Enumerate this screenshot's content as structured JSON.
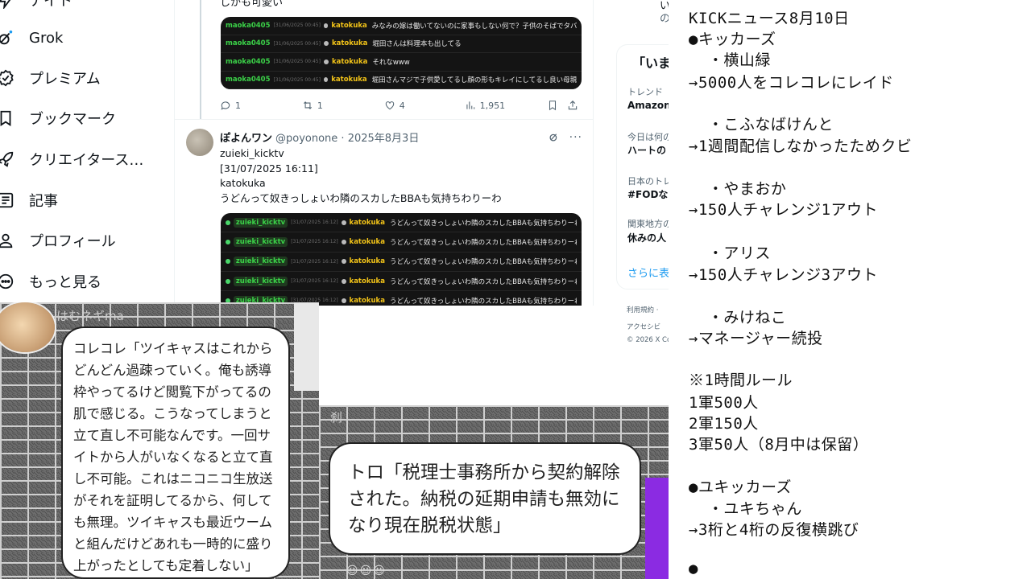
{
  "nav": {
    "items": [
      {
        "label": "ナイト",
        "icon": "lightning-icon"
      },
      {
        "label": "Grok",
        "icon": "grok-icon"
      },
      {
        "label": "プレミアム",
        "icon": "verified-badge-icon"
      },
      {
        "label": "ブックマーク",
        "icon": "bookmark-icon"
      },
      {
        "label": "クリエイタース…",
        "icon": "rocket-icon"
      },
      {
        "label": "記事",
        "icon": "article-icon"
      },
      {
        "label": "プロフィール",
        "icon": "person-icon"
      },
      {
        "label": "もっと見る",
        "icon": "more-circle-icon"
      }
    ]
  },
  "feed": {
    "top_text": "しかも可愛い",
    "post1": {
      "chat": [
        {
          "user": "maoka0405",
          "ts": "[31/06/2025 00:45]",
          "name": "katokuka",
          "msg": "みなみの嫁は働いてないのに家事もしない何で？子供のそばでタバコも吸"
        },
        {
          "user": "maoka0405",
          "ts": "[31/06/2025 00:45]",
          "name": "katokuka",
          "msg": "堀田さんは料理本も出してる"
        },
        {
          "user": "maoka0405",
          "ts": "[31/06/2025 00:45]",
          "name": "katokuka",
          "msg": "それなwww"
        },
        {
          "user": "maoka0405",
          "ts": "[31/06/2025 00:45]",
          "name": "katokuka",
          "msg": "堀田さんマジで子供愛してるし顔の形もキレイにしてるし良い母親しかも可"
        }
      ],
      "actions": {
        "replies": "1",
        "reposts": "1",
        "likes": "4",
        "views": "1,951"
      }
    },
    "post2": {
      "display_name": "ぽよんワン",
      "handle": "@poyonone · 2025年8月3日",
      "body_lines": [
        "zuieki_kicktv",
        "[31/07/2025 16:11]",
        "katokuka",
        "うどんって奴きっしょいわ隣のスカしたBBAも気持ちわりーわ"
      ],
      "chat_user": "zuieki_kicktv",
      "chat_ts": "[31/07/2025 16:12]",
      "chat_name": "katokuka",
      "chat_msg": "うどんって奴きっしょいわ隣のスカしたBBAも気持ちわりーわ"
    }
  },
  "rside": {
    "heading": "「いま",
    "line_a1": "い",
    "line_a2": "の",
    "trend1_meta": "トレンド",
    "trend1_title": "Amazon",
    "trend2_meta": "今日は何の",
    "trend2_title": "ハートの",
    "trend3_meta": "日本のトレ",
    "trend3_title": "#FODな",
    "trend4_meta": "関東地方の",
    "trend4_title": "休みの人",
    "show_more": "さらに表",
    "footer1": "利用規約 ·",
    "footer2": "アクセシビ",
    "footer3": "© 2026 X Co"
  },
  "photo1": {
    "label": "はむネギma",
    "text": "コレコレ「ツイキャスはこれからどんどん過疎っていく。俺も誘導枠やってるけど閲覧下がってるの肌で感じる。こうなってしまうと立て直し不可能なんです。一回サイトから人がいなくなると立て直し不可能。これはニコニコ生放送がそれを証明してるから、何しても無理。ツイキャスも最近ウームと組んだけどあれも一時的に盛り上がったとしても定着しない」"
  },
  "photo2": {
    "label": "刹",
    "text": "トロ「税理士事務所から契約解除された。納税の延期申請も無効になり現在脱税状態」"
  },
  "news": {
    "lines": [
      "KICKニュース8月10日",
      "●キッカーズ",
      "  ・横山緑",
      "→5000人をコレコレにレイド",
      "",
      "  ・こふなばけんと",
      "→1週間配信しなかったためクビ",
      "",
      "  ・やまおか",
      "→150人チャレンジ1アウト",
      "",
      "  ・アリス",
      "→150人チャレンジ3アウト",
      "",
      "  ・みけねこ",
      "→マネージャー続投",
      "",
      "※1時間ルール",
      "1軍500人",
      "2軍150人",
      "3軍50人（8月中は保留）",
      "",
      "●ユキッカーズ",
      "  ・ユキちゃん",
      "→3桁と4桁の反復横跳び",
      "",
      "●"
    ]
  }
}
